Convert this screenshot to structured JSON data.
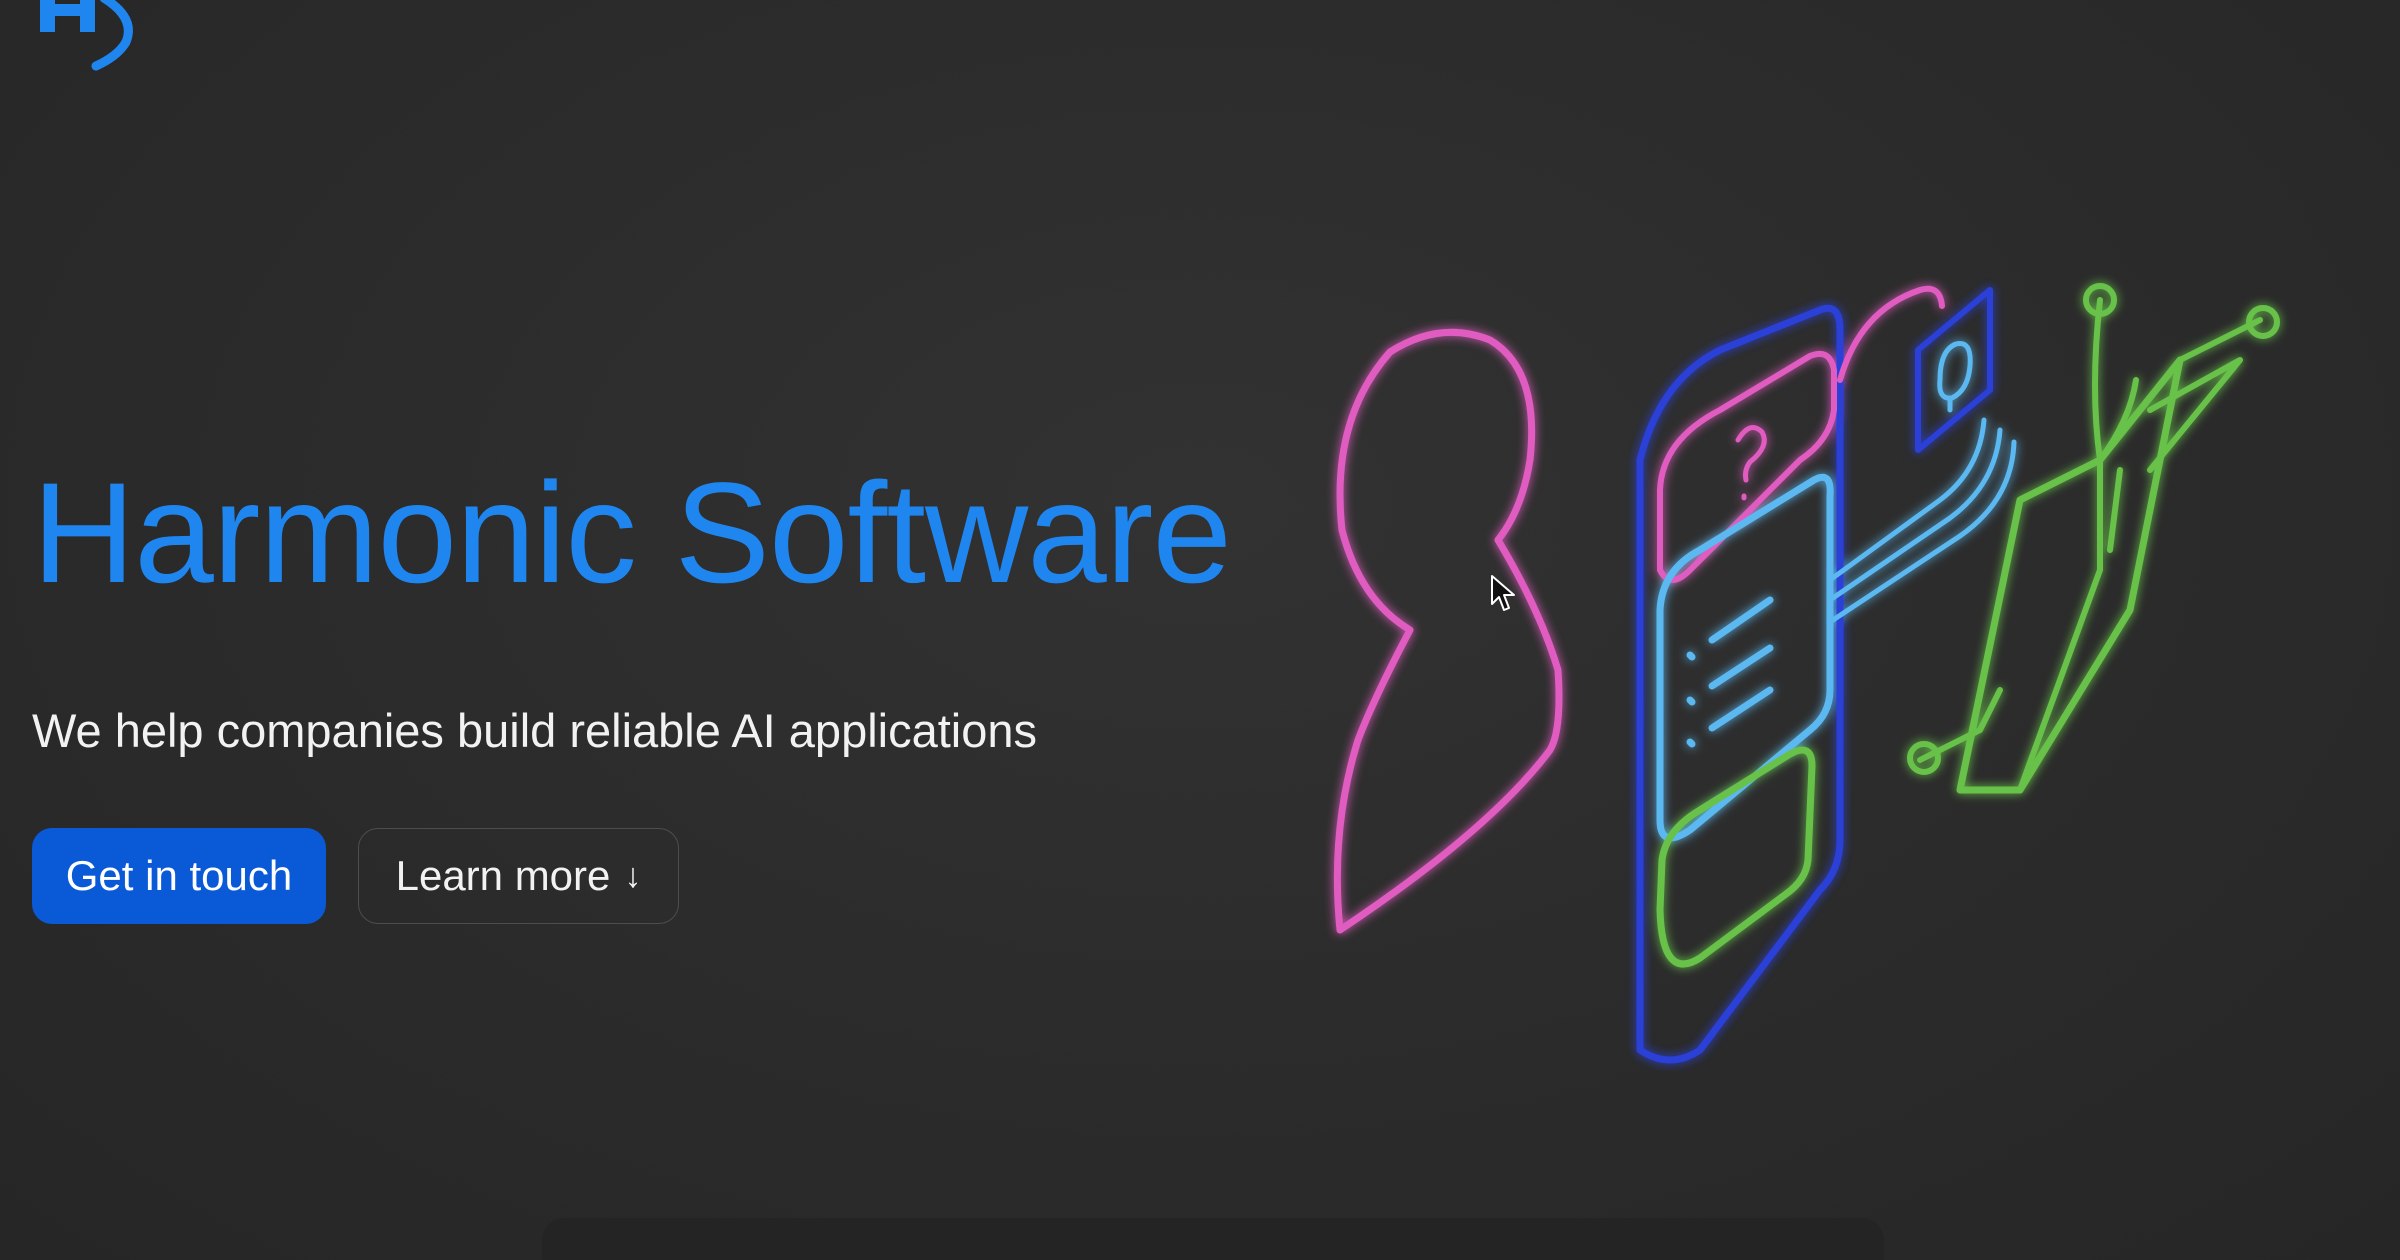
{
  "brand": {
    "logo_icon": "harmonic-logo-icon",
    "accent_color": "#1f86f0"
  },
  "hero": {
    "title": "Harmonic Software",
    "subtitle": "We help companies build reliable AI applications"
  },
  "actions": {
    "primary_label": "Get in touch",
    "secondary_label": "Learn more",
    "secondary_icon": "↓",
    "primary_color": "#0a5ad8"
  },
  "illustration": {
    "icon": "neon-ai-illustration",
    "colors": [
      "#e05cc0",
      "#2b3fd6",
      "#5bb8f0",
      "#67c24a"
    ]
  }
}
